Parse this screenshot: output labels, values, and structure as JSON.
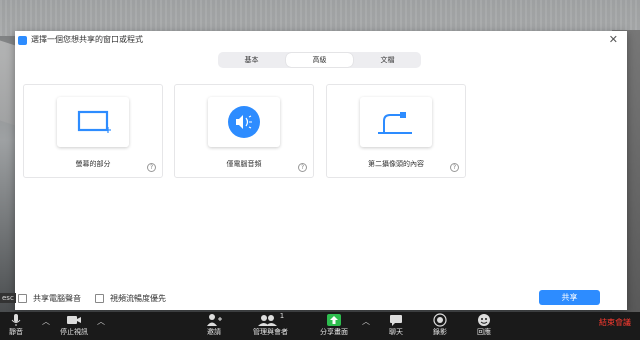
{
  "dialog": {
    "title": "選擇一個您想共享的窗口或程式",
    "tabs": [
      {
        "label": "基本",
        "active": false
      },
      {
        "label": "高級",
        "active": true
      },
      {
        "label": "文檔",
        "active": false
      }
    ],
    "options": [
      {
        "label": "螢幕的部分",
        "icon": "screen-portion-icon",
        "help": "?"
      },
      {
        "label": "僅電腦音頻",
        "icon": "speaker-icon",
        "help": "?"
      },
      {
        "label": "第二攝像頭的內容",
        "icon": "document-camera-icon",
        "help": "?"
      }
    ],
    "footer": {
      "share_sound_label": "共享電腦聲音",
      "optimize_video_label": "視頻流暢度優先",
      "share_button": "共享"
    }
  },
  "toolbar": {
    "mute": "靜音",
    "stop_video": "停止視訊",
    "invite": "邀請",
    "participants": "管理與會者",
    "participant_count": "1",
    "share_screen": "分享畫面",
    "chat": "聊天",
    "record": "錄影",
    "reactions": "回應",
    "end_meeting": "結束會議",
    "esc_hint": "esc"
  },
  "colors": {
    "accent": "#2d8cff",
    "share_green": "#2dbd4e",
    "end_red": "#ff3b30"
  }
}
